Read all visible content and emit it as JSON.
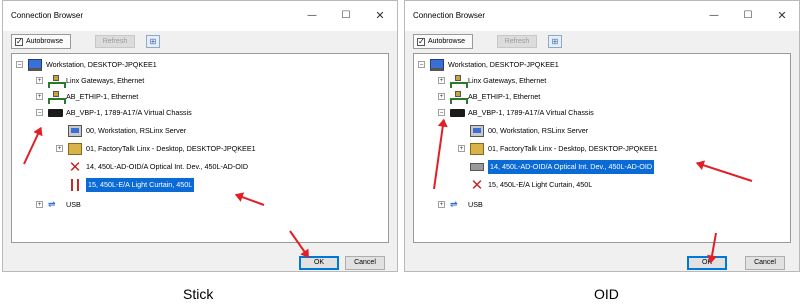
{
  "window": {
    "title": "Connection Browser",
    "minimize": "—",
    "maximize": "☐",
    "close": "✕"
  },
  "toolbar": {
    "autobrowse_label": "Autobrowse",
    "autobrowse_checked": "✓",
    "refresh_label": "Refresh",
    "icon": "tree-view-icon"
  },
  "tree": {
    "workstation": "Workstation, DESKTOP-JPQKEE1",
    "linx_gateways": "Linx Gateways, Ethernet",
    "ab_ethip": "AB_ETHIP-1, Ethernet",
    "ab_vbp": "AB_VBP-1, 1789-A17/A Virtual Chassis",
    "item_00": "00, Workstation, RSLinx Server",
    "item_01": "01, FactoryTalk Linx - Desktop, DESKTOP-JPQKEE1",
    "item_14": "14, 450L-AD-OID/A Optical Int. Dev., 450L-AD-OID",
    "item_15": "15, 450L-E/A Light Curtain, 450L",
    "usb": "USB"
  },
  "buttons": {
    "ok": "OK",
    "cancel": "Cancel"
  },
  "captions": {
    "left": "Stick",
    "right": "OID"
  },
  "colors": {
    "selection": "#0a6bd6",
    "annotation_arrow": "#e01f26"
  }
}
